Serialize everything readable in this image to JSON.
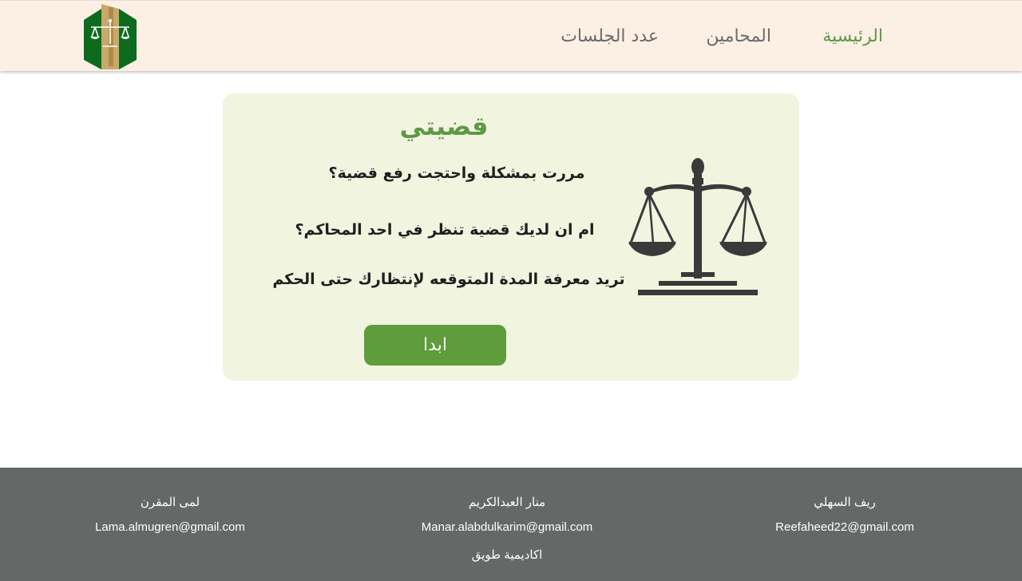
{
  "nav": {
    "home": "الرئيسية",
    "lawyers": "المحامين",
    "sessions": "عدد الجلسات",
    "logo": "scales-of-justice-logo",
    "active_color": "#5f9847",
    "background_color": "#fcf0e5"
  },
  "card": {
    "title": "قضيتي",
    "lines": [
      "مررت بمشكلة واحتجت رفع قضية؟",
      "ام ان لديك قضية تنظر في احد المحاكم؟",
      "تريد معرفة المدة المتوقعه لإنتظارك حتى الحكم"
    ],
    "button": "ابدا",
    "icon": "scales-of-justice-icon",
    "background_color": "#f1f5e0",
    "button_color": "#5f9c3c"
  },
  "footer": {
    "members": [
      {
        "name": "ريف السهلي",
        "email": "Reefaheed22@gmail.com"
      },
      {
        "name": "منار العبدالكريم",
        "email": "Manar.alabdulkarim@gmail.com"
      },
      {
        "name": "لمى المقرن",
        "email": "Lama.almugren@gmail.com"
      }
    ],
    "organization": "اكاديمية طويق",
    "background_color": "#646866"
  }
}
